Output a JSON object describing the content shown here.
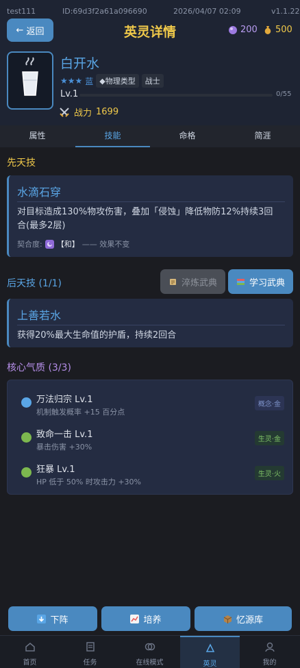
{
  "status_bar": {
    "user": "test111",
    "id": "ID:69d3f2a61a096690",
    "datetime": "2026/04/07 02:09",
    "version": "v1.1.22"
  },
  "header": {
    "back_label": "返回",
    "title": "英灵详情",
    "gems": "200",
    "gold": "500"
  },
  "hero": {
    "name": "白开水",
    "stars": "★★★",
    "rarity": "蓝",
    "type_tag": "◆物理类型",
    "class_tag": "战士",
    "level": "Lv.1",
    "xp_text": "0/55",
    "xp_progress": 0,
    "power_label": "战力",
    "power_value": "1699"
  },
  "tabs": [
    "属性",
    "技能",
    "命格",
    "简涯"
  ],
  "active_tab_index": 1,
  "innate": {
    "section_title": "先天技",
    "skill_name": "水滴石穿",
    "description": "对目标造成130%物攻伤害，叠加「侵蚀」降低物防12%持续3回合(最多2层)",
    "affinity_label": "契合度:",
    "affinity_value": "【和】",
    "affinity_effect": "—— 效果不变"
  },
  "acquired": {
    "section_title": "后天技 (1/1)",
    "refine_button": "淬炼武典",
    "learn_button": "学习武典",
    "skill_name": "上善若水",
    "description": "获得20%最大生命值的护盾，持续2回合"
  },
  "core": {
    "section_title": "核心气质 (3/3)",
    "traits": [
      {
        "name": "万法归宗 Lv.1",
        "desc": "机制触发概率 +15 百分点",
        "tag": "概念·金",
        "dot_color": "#5aa6e6",
        "tag_color": "#7d92c8",
        "tag_bg": "#2c3454"
      },
      {
        "name": "致命一击 Lv.1",
        "desc": "暴击伤害 +30%",
        "tag": "生灵·金",
        "dot_color": "#7db84f",
        "tag_color": "#7fc166",
        "tag_bg": "#243a32"
      },
      {
        "name": "狂暴 Lv.1",
        "desc": "HP 低于 50% 时攻击力 +30%",
        "tag": "生灵·火",
        "dot_color": "#7db84f",
        "tag_color": "#7fc166",
        "tag_bg": "#243a32"
      }
    ]
  },
  "actions": {
    "unequip": "下阵",
    "train": "培养",
    "memory": "忆源库"
  },
  "nav": {
    "items": [
      "首页",
      "任务",
      "在线模式",
      "英灵",
      "我的"
    ],
    "active_index": 3
  },
  "colors": {
    "accent": "#4a89c0",
    "gold": "#f0c94a",
    "skill_blue": "#5aa6e6",
    "core_purple": "#b58ee8"
  }
}
